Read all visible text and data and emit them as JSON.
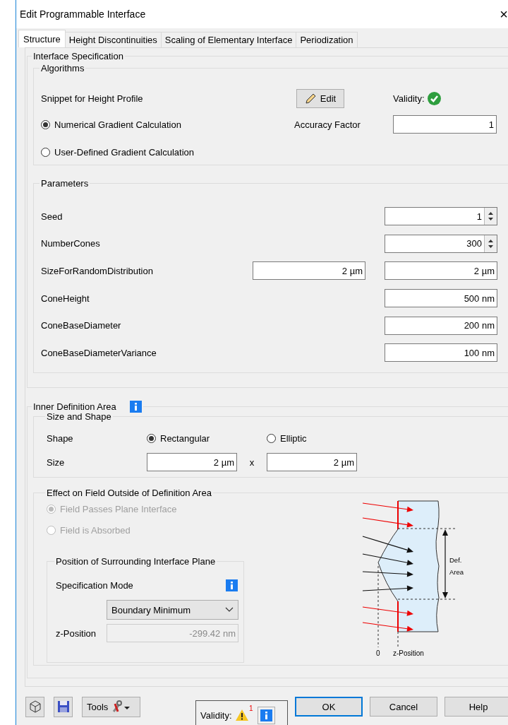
{
  "window": {
    "title": "Edit Programmable Interface",
    "close": "×"
  },
  "tabs": [
    {
      "label": "Structure",
      "selected": true
    },
    {
      "label": "Height Discontinuities",
      "selected": false
    },
    {
      "label": "Scaling of Elementary Interface",
      "selected": false
    },
    {
      "label": "Periodization",
      "selected": false
    }
  ],
  "interface_specification": {
    "title": "Interface Specification",
    "algorithms": {
      "title": "Algorithms",
      "snippet_label": "Snippet for Height Profile",
      "edit_button": "Edit",
      "validity_label": "Validity:",
      "valid": true,
      "gradient_options": [
        {
          "label": "Numerical Gradient Calculation",
          "selected": true
        },
        {
          "label": "User-Defined Gradient Calculation",
          "selected": false
        }
      ],
      "accuracy_label": "Accuracy Factor",
      "accuracy_value": "1"
    },
    "parameters": {
      "title": "Parameters",
      "rows": [
        {
          "name": "Seed",
          "kind": "spinner",
          "values": [
            "1"
          ]
        },
        {
          "name": "NumberCones",
          "kind": "spinner",
          "values": [
            "300"
          ]
        },
        {
          "name": "SizeForRandomDistribution",
          "kind": "pair",
          "values": [
            "2 µm",
            "2 µm"
          ]
        },
        {
          "name": "ConeHeight",
          "kind": "field",
          "values": [
            "500 nm"
          ]
        },
        {
          "name": "ConeBaseDiameter",
          "kind": "field",
          "values": [
            "200 nm"
          ]
        },
        {
          "name": "ConeBaseDiameterVariance",
          "kind": "field",
          "values": [
            "100 nm"
          ]
        }
      ]
    }
  },
  "inner_definition_area": {
    "title": "Inner Definition Area",
    "size_and_shape": {
      "title": "Size and Shape",
      "shape_label": "Shape",
      "shapes": [
        {
          "label": "Rectangular",
          "selected": true
        },
        {
          "label": "Elliptic",
          "selected": false
        }
      ],
      "size_label": "Size",
      "size_values": [
        "2 µm",
        "2 µm"
      ],
      "separator": "x"
    },
    "effect": {
      "title": "Effect on Field Outside of Definition Area",
      "options": [
        {
          "label": "Field Passes Plane Interface",
          "selected": true,
          "disabled": true
        },
        {
          "label": "Field is Absorbed",
          "selected": false,
          "disabled": true
        }
      ],
      "surrounding_plane": {
        "title": "Position of Surrounding Interface Plane",
        "mode_label": "Specification Mode",
        "mode_value": "Boundary Minimum",
        "z_label": "z-Position",
        "z_value": "-299.42 nm",
        "z_disabled": true
      },
      "diagram": {
        "area_label": [
          "Def.",
          "Area"
        ],
        "origin_label": "0",
        "z_label": "z-Position"
      }
    }
  },
  "footer": {
    "tools_button": "Tools",
    "validity_label": "Validity:",
    "warning_count": "1",
    "buttons": [
      {
        "label": "OK",
        "default": true
      },
      {
        "label": "Cancel",
        "default": false
      },
      {
        "label": "Help",
        "default": false
      }
    ]
  }
}
